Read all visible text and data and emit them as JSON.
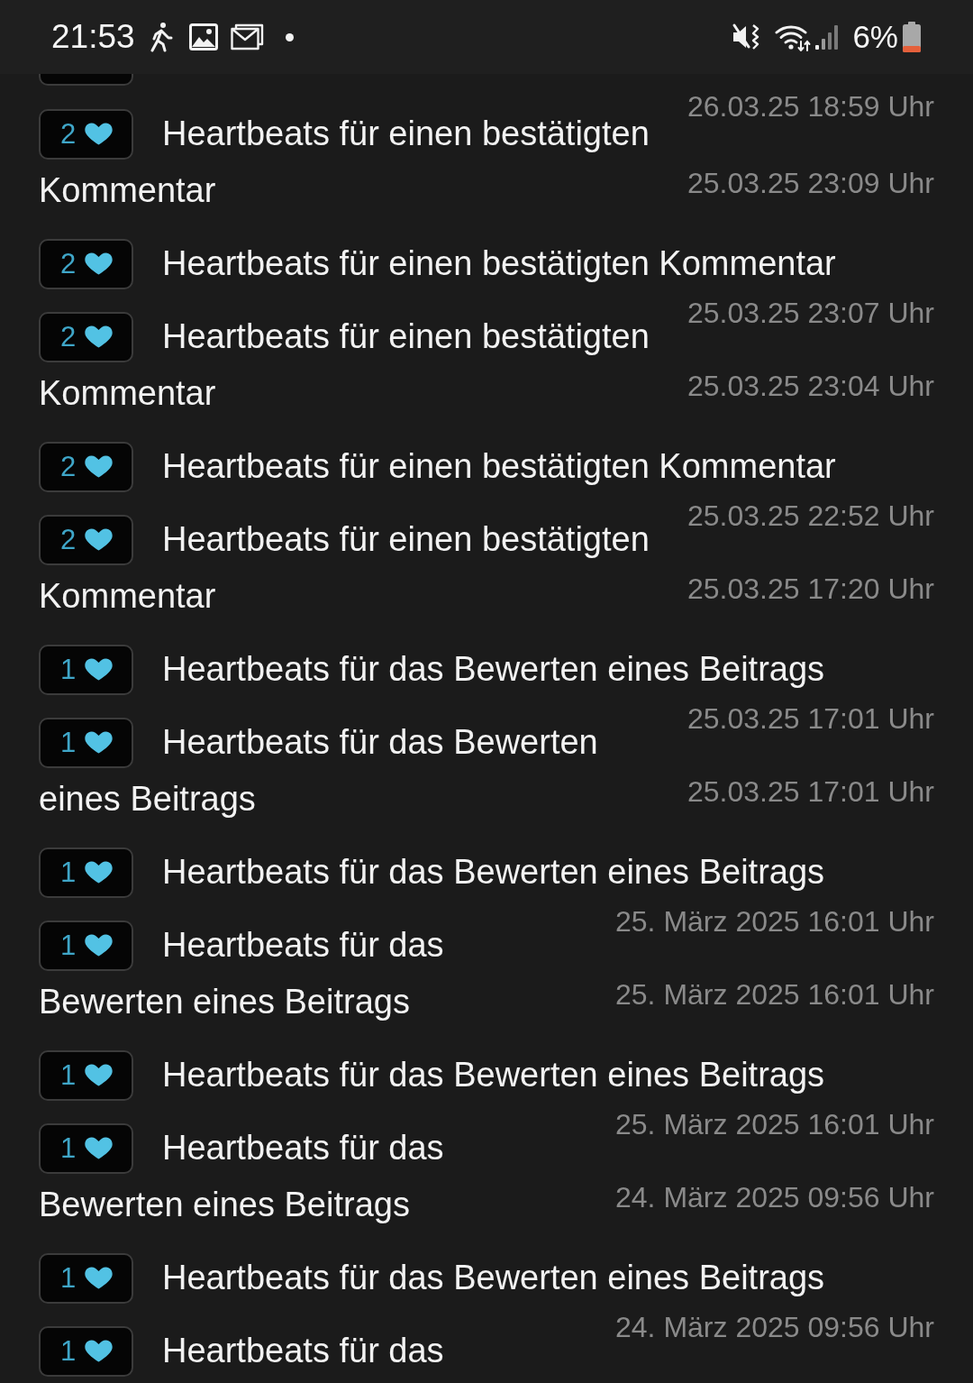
{
  "status_bar": {
    "time": "21:53",
    "battery": "6%"
  },
  "entries": [
    {
      "kind": "cutoff",
      "date": "26.03.25 18:59 Uhr"
    },
    {
      "kind": "entry",
      "count": "2",
      "lines": [
        "Heartbeats für einen bestätigten",
        "Kommentar"
      ],
      "date": "25.03.25 23:09 Uhr"
    },
    {
      "kind": "entry",
      "count": "2",
      "lines": [
        "Heartbeats für einen bestätigten Kommentar"
      ],
      "date": "25.03.25 23:07 Uhr"
    },
    {
      "kind": "entry",
      "count": "2",
      "lines": [
        "Heartbeats für einen bestätigten",
        "Kommentar"
      ],
      "date": "25.03.25 23:04 Uhr"
    },
    {
      "kind": "entry",
      "count": "2",
      "lines": [
        "Heartbeats für einen bestätigten Kommentar"
      ],
      "date": "25.03.25 22:52 Uhr"
    },
    {
      "kind": "entry",
      "count": "2",
      "lines": [
        "Heartbeats für einen bestätigten",
        "Kommentar"
      ],
      "date": "25.03.25 17:20 Uhr"
    },
    {
      "kind": "entry",
      "count": "1",
      "lines": [
        "Heartbeats für das Bewerten eines Beitrags"
      ],
      "date": "25.03.25 17:01 Uhr"
    },
    {
      "kind": "entry",
      "count": "1",
      "lines": [
        "Heartbeats für das Bewerten",
        "eines Beitrags"
      ],
      "date": "25.03.25 17:01 Uhr"
    },
    {
      "kind": "entry",
      "count": "1",
      "lines": [
        "Heartbeats für das Bewerten eines Beitrags"
      ],
      "date": "25. März 2025 16:01 Uhr"
    },
    {
      "kind": "entry",
      "count": "1",
      "lines": [
        "Heartbeats für das",
        "Bewerten eines Beitrags"
      ],
      "date": "25. März 2025 16:01 Uhr"
    },
    {
      "kind": "entry",
      "count": "1",
      "lines": [
        "Heartbeats für das Bewerten eines Beitrags"
      ],
      "date": "25. März 2025 16:01 Uhr"
    },
    {
      "kind": "entry",
      "count": "1",
      "lines": [
        "Heartbeats für das",
        "Bewerten eines Beitrags"
      ],
      "date": "24. März 2025 09:56 Uhr"
    },
    {
      "kind": "entry",
      "count": "1",
      "lines": [
        "Heartbeats für das Bewerten eines Beitrags"
      ],
      "date": "24. März 2025 09:56 Uhr"
    },
    {
      "kind": "entry",
      "count": "1",
      "lines": [
        "Heartbeats für das"
      ]
    }
  ]
}
